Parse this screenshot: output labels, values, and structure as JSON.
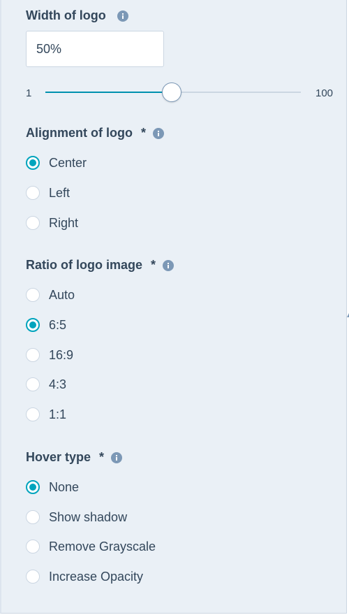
{
  "width_of_logo": {
    "label": "Width of logo",
    "info_icon": "info-icon",
    "value": "50%",
    "slider": {
      "min_label": "1",
      "max_label": "100",
      "min": 1,
      "max": 100,
      "value": 50
    }
  },
  "alignment_of_logo": {
    "label": "Alignment of logo",
    "required_mark": "*",
    "info_icon": "info-icon",
    "options": [
      {
        "label": "Center",
        "selected": true
      },
      {
        "label": "Left",
        "selected": false
      },
      {
        "label": "Right",
        "selected": false
      }
    ]
  },
  "ratio_of_logo_image": {
    "label": "Ratio of logo image",
    "required_mark": "*",
    "info_icon": "info-icon",
    "options": [
      {
        "label": "Auto",
        "selected": false
      },
      {
        "label": "6:5",
        "selected": true
      },
      {
        "label": "16:9",
        "selected": false
      },
      {
        "label": "4:3",
        "selected": false
      },
      {
        "label": "1:1",
        "selected": false
      }
    ]
  },
  "hover_type": {
    "label": "Hover type",
    "required_mark": "*",
    "info_icon": "info-icon",
    "options": [
      {
        "label": "None",
        "selected": true
      },
      {
        "label": "Show shadow",
        "selected": false
      },
      {
        "label": "Remove Grayscale",
        "selected": false
      },
      {
        "label": "Increase Opacity",
        "selected": false
      }
    ]
  },
  "colors": {
    "panel_background": "#eaf0f6",
    "text": "#33475b",
    "accent": "#00a4bd",
    "slider_fill": "#0091ae",
    "border": "#cbd6e2",
    "info_icon": "#7c98b6"
  }
}
